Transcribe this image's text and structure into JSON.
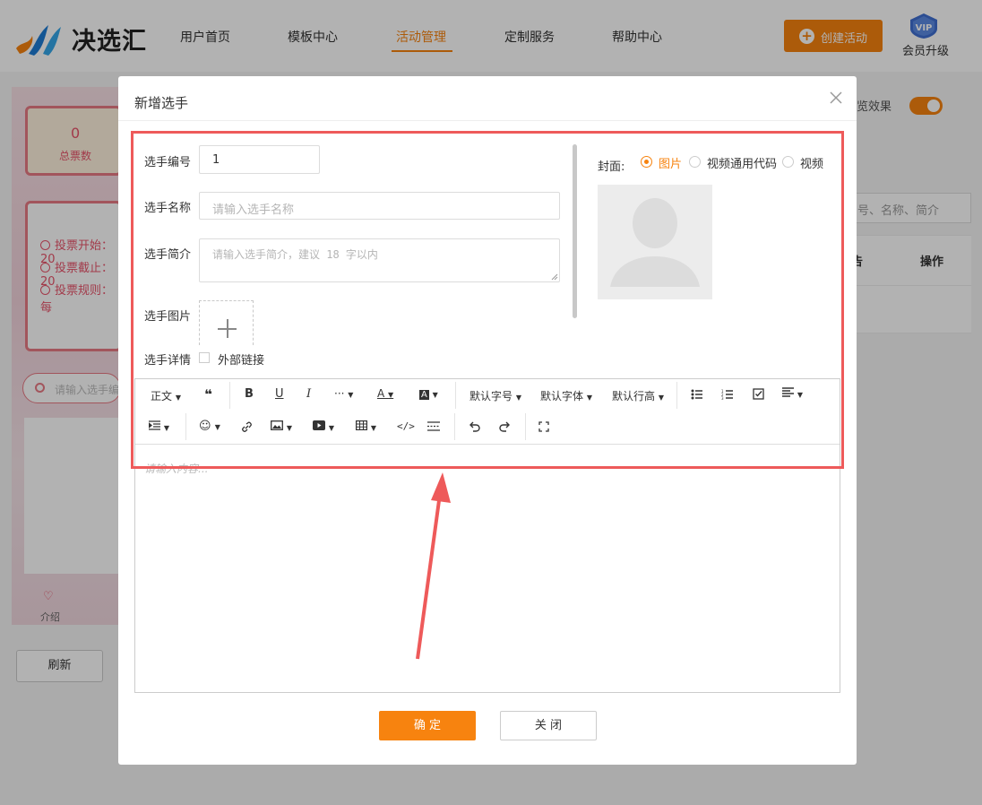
{
  "header": {
    "brand": "决选汇",
    "nav": [
      "用户首页",
      "模板中心",
      "活动管理",
      "定制服务",
      "帮助中心"
    ],
    "active_nav": "活动管理",
    "create_button": "创建活动",
    "vip_badge": "VIP",
    "vip_label": "会员升级"
  },
  "background": {
    "stat_value": "0",
    "stat_label": "总票数",
    "info_lines": [
      "投票开始：20",
      "投票截止：20",
      "投票规则：每"
    ],
    "search_placeholder": "请输入选手编",
    "intro_label": "介绍",
    "refresh": "刷新",
    "preview_label": "览效果",
    "right_search_placeholder": "号、名称、简介",
    "table_header_col": "告",
    "table_header_ops": "操作"
  },
  "modal": {
    "title": "新增选手",
    "fields": {
      "number_label": "选手编号",
      "number_value": "1",
      "name_label": "选手名称",
      "name_placeholder": "请输入选手名称",
      "intro_label": "选手简介",
      "intro_placeholder": "请输入选手简介，建议 18 字以内",
      "image_label": "选手图片",
      "detail_label": "选手详情",
      "external_link_label": "外部链接"
    },
    "cover": {
      "label": "封面:",
      "options": [
        "图片",
        "视频通用代码",
        "视频"
      ],
      "selected": "图片"
    },
    "toolbar": {
      "paragraph": "正文",
      "font_size": "默认字号",
      "font_family": "默认字体",
      "line_height": "默认行高"
    },
    "editor_placeholder": "请输入内容...",
    "confirm": "确 定",
    "close": "关 闭"
  },
  "colors": {
    "accent": "#f7830f",
    "highlight": "#ee5a5a",
    "pink": "#e8546b"
  }
}
